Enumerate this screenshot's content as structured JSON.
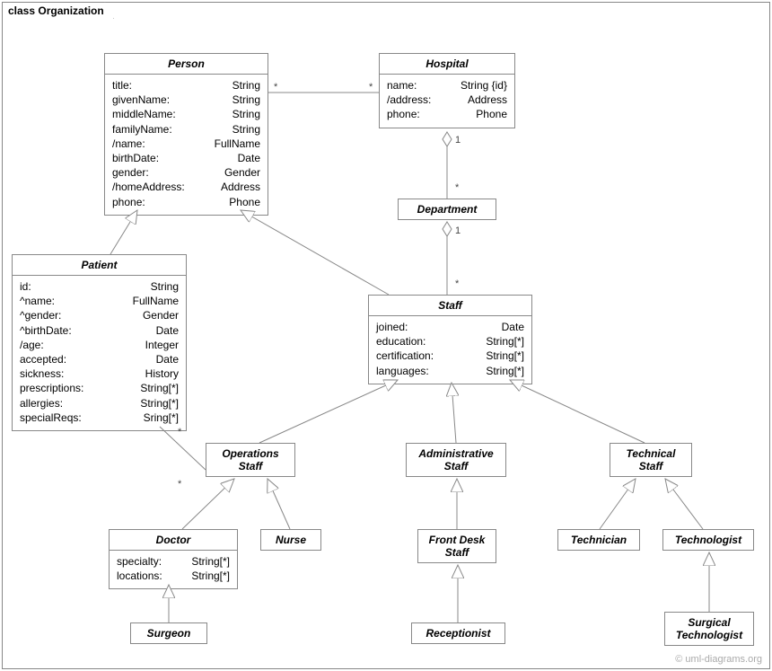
{
  "frame_title": "class Organization",
  "watermark": "© uml-diagrams.org",
  "classes": {
    "person": {
      "name": "Person",
      "attrs": [
        {
          "n": "title:",
          "t": "String"
        },
        {
          "n": "givenName:",
          "t": "String"
        },
        {
          "n": "middleName:",
          "t": "String"
        },
        {
          "n": "familyName:",
          "t": "String"
        },
        {
          "n": "/name:",
          "t": "FullName"
        },
        {
          "n": "birthDate:",
          "t": "Date"
        },
        {
          "n": "gender:",
          "t": "Gender"
        },
        {
          "n": "/homeAddress:",
          "t": "Address"
        },
        {
          "n": "phone:",
          "t": "Phone"
        }
      ]
    },
    "hospital": {
      "name": "Hospital",
      "attrs": [
        {
          "n": "name:",
          "t": "String {id}"
        },
        {
          "n": "/address:",
          "t": "Address"
        },
        {
          "n": "phone:",
          "t": "Phone"
        }
      ]
    },
    "department": {
      "name": "Department"
    },
    "patient": {
      "name": "Patient",
      "attrs": [
        {
          "n": "id:",
          "t": "String"
        },
        {
          "n": "^name:",
          "t": "FullName"
        },
        {
          "n": "^gender:",
          "t": "Gender"
        },
        {
          "n": "^birthDate:",
          "t": "Date"
        },
        {
          "n": "/age:",
          "t": "Integer"
        },
        {
          "n": "accepted:",
          "t": "Date"
        },
        {
          "n": "sickness:",
          "t": "History"
        },
        {
          "n": "prescriptions:",
          "t": "String[*]"
        },
        {
          "n": "allergies:",
          "t": "String[*]"
        },
        {
          "n": "specialReqs:",
          "t": "Sring[*]"
        }
      ]
    },
    "staff": {
      "name": "Staff",
      "attrs": [
        {
          "n": "joined:",
          "t": "Date"
        },
        {
          "n": "education:",
          "t": "String[*]"
        },
        {
          "n": "certification:",
          "t": "String[*]"
        },
        {
          "n": "languages:",
          "t": "String[*]"
        }
      ]
    },
    "ops_staff": {
      "name": "Operations",
      "name2": "Staff"
    },
    "admin_staff": {
      "name": "Administrative",
      "name2": "Staff"
    },
    "tech_staff": {
      "name": "Technical",
      "name2": "Staff"
    },
    "doctor": {
      "name": "Doctor",
      "attrs": [
        {
          "n": "specialty:",
          "t": "String[*]"
        },
        {
          "n": "locations:",
          "t": "String[*]"
        }
      ]
    },
    "nurse": {
      "name": "Nurse"
    },
    "frontdesk": {
      "name": "Front Desk",
      "name2": "Staff"
    },
    "technician": {
      "name": "Technician"
    },
    "technologist": {
      "name": "Technologist"
    },
    "surgeon": {
      "name": "Surgeon"
    },
    "receptionist": {
      "name": "Receptionist"
    },
    "surg_tech": {
      "name": "Surgical",
      "name2": "Technologist"
    }
  },
  "mult": {
    "ph_star_l": "*",
    "ph_star_r": "*",
    "hd_one": "1",
    "hd_star": "*",
    "ds_one": "1",
    "ds_star": "*",
    "op_star_t": "*",
    "op_star_b": "*"
  }
}
